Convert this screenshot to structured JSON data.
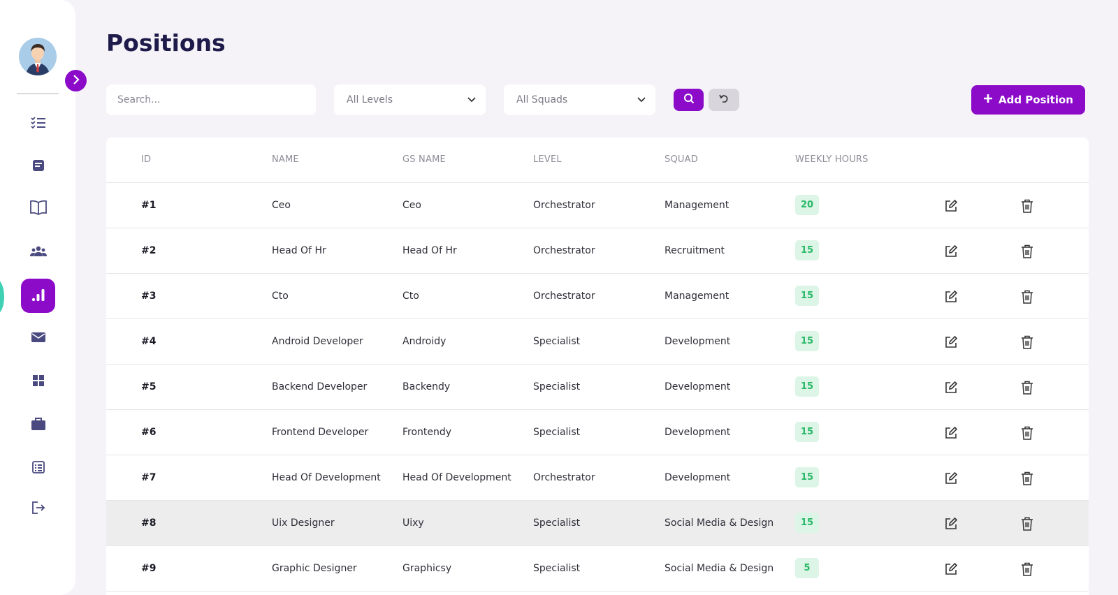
{
  "page": {
    "title": "Positions"
  },
  "filters": {
    "search_placeholder": "Search...",
    "levels_selected": "All Levels",
    "squads_selected": "All Squads",
    "add_button": "Add Position"
  },
  "sidebar": {
    "items": [
      {
        "icon": "checklist-icon"
      },
      {
        "icon": "note-icon"
      },
      {
        "icon": "book-icon"
      },
      {
        "icon": "team-icon"
      },
      {
        "icon": "chart-icon",
        "active": true
      },
      {
        "icon": "mail-icon"
      },
      {
        "icon": "grid-icon"
      },
      {
        "icon": "briefcase-icon"
      },
      {
        "icon": "list-icon"
      },
      {
        "icon": "logout-icon"
      }
    ]
  },
  "table": {
    "headers": [
      "ID",
      "NAME",
      "GS NAME",
      "LEVEL",
      "SQUAD",
      "WEEKLY HOURS"
    ],
    "rows": [
      {
        "id": "#1",
        "name": "Ceo",
        "gs_name": "Ceo",
        "level": "Orchestrator",
        "squad": "Management",
        "hours": "20"
      },
      {
        "id": "#2",
        "name": "Head Of Hr",
        "gs_name": "Head Of Hr",
        "level": "Orchestrator",
        "squad": "Recruitment",
        "hours": "15"
      },
      {
        "id": "#3",
        "name": "Cto",
        "gs_name": "Cto",
        "level": "Orchestrator",
        "squad": "Management",
        "hours": "15"
      },
      {
        "id": "#4",
        "name": "Android Developer",
        "gs_name": "Androidy",
        "level": "Specialist",
        "squad": "Development",
        "hours": "15"
      },
      {
        "id": "#5",
        "name": "Backend Developer",
        "gs_name": "Backendy",
        "level": "Specialist",
        "squad": "Development",
        "hours": "15"
      },
      {
        "id": "#6",
        "name": "Frontend Developer",
        "gs_name": "Frontendy",
        "level": "Specialist",
        "squad": "Development",
        "hours": "15"
      },
      {
        "id": "#7",
        "name": "Head Of Development",
        "gs_name": "Head Of Development",
        "level": "Orchestrator",
        "squad": "Development",
        "hours": "15"
      },
      {
        "id": "#8",
        "name": "Uix Designer",
        "gs_name": "Uixy",
        "level": "Specialist",
        "squad": "Social Media & Design",
        "hours": "15"
      },
      {
        "id": "#9",
        "name": "Graphic Designer",
        "gs_name": "Graphicsy",
        "level": "Specialist",
        "squad": "Social Media & Design",
        "hours": "5"
      }
    ]
  },
  "colors": {
    "accent": "#8b0bc9",
    "badge_bg": "#dcf5e6",
    "badge_text": "#27b865",
    "title": "#1e1b4b"
  }
}
